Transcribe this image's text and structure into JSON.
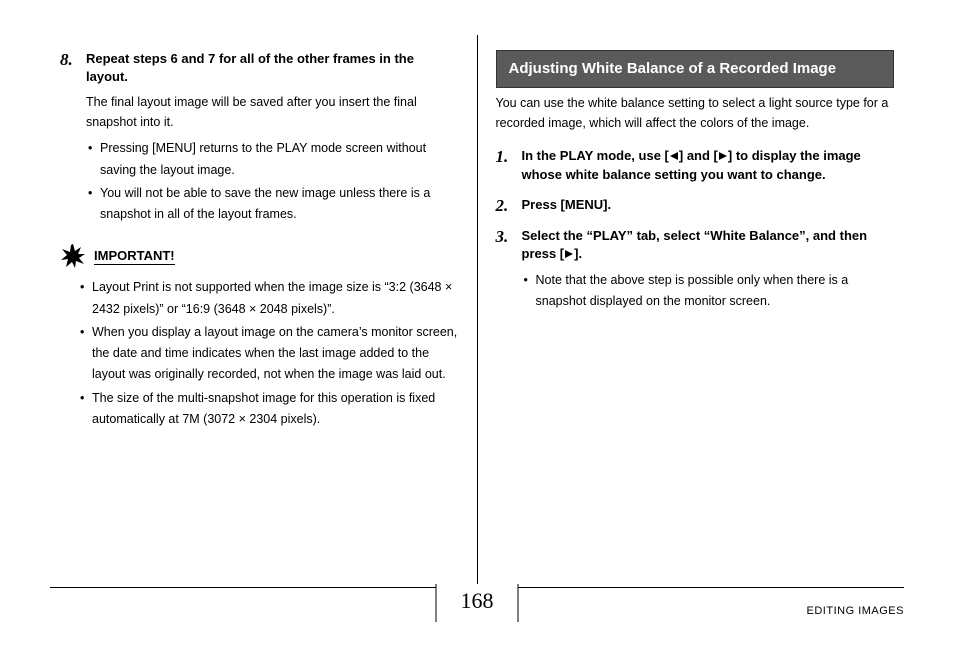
{
  "left": {
    "step8": {
      "num": "8.",
      "title": "Repeat steps 6 and 7 for all of the other frames in the layout.",
      "desc": "The final layout image will be saved after you insert the final snapshot into it.",
      "bullets": [
        "Pressing [MENU] returns to the PLAY mode screen without saving the layout image.",
        "You will not be able to save the new image unless there is a snapshot in all of the layout frames."
      ]
    },
    "important": {
      "label": "IMPORTANT!",
      "bullets": [
        "Layout Print is not supported when the image size is “3:2 (3648 × 2432 pixels)” or “16:9 (3648 × 2048 pixels)”.",
        "When you display a layout image on the camera’s monitor screen, the date and time indicates when the last image added to the layout was originally recorded, not when the image was laid out.",
        "The size of the multi-snapshot image for this operation is fixed automatically at 7M (3072 × 2304 pixels)."
      ]
    }
  },
  "right": {
    "header": "Adjusting White Balance of a Recorded Image",
    "intro": "You can use the white balance setting to select a light source type for a recorded image, which will affect the colors of the image.",
    "step1": {
      "num": "1.",
      "pre": "In the PLAY mode, use [",
      "mid": "] and [",
      "post": "] to display the image whose white balance setting you want to change."
    },
    "step2": {
      "num": "2.",
      "title": "Press [MENU]."
    },
    "step3": {
      "num": "3.",
      "pre": "Select the “PLAY” tab, select “White Balance”, and then press [",
      "post": "].",
      "bullet": "Note that the above step is possible only when there is a snapshot displayed on the monitor screen."
    }
  },
  "footer": {
    "page": "168",
    "section": "EDITING IMAGES"
  }
}
